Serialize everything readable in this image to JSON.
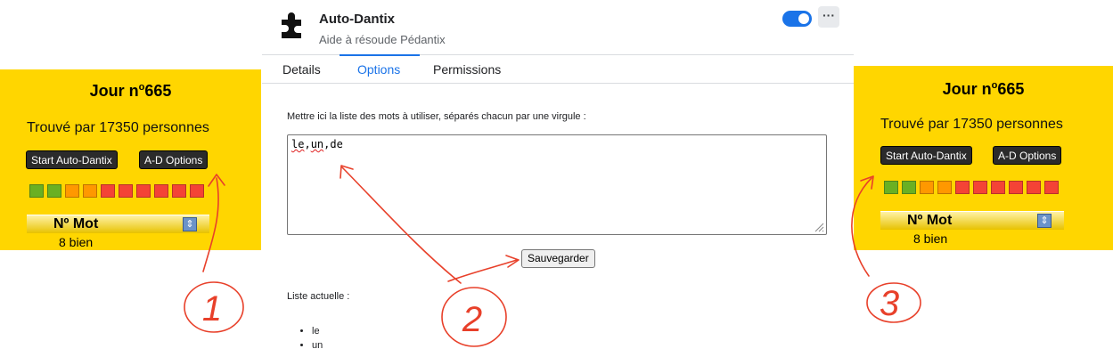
{
  "left_panel": {
    "jour_label": "Jour n",
    "jour_sup": "o",
    "jour_number": "665",
    "found_text": "Trouvé par 17350 personnes",
    "start_button": "Start Auto-Dantix",
    "options_button": "A-D Options",
    "squares": [
      "#6ab023",
      "#6ab023",
      "#ff9800",
      "#ff9800",
      "#f44336",
      "#f44336",
      "#f44336",
      "#f44336",
      "#f44336",
      "#f44336"
    ],
    "header_label": "Nº Mot",
    "sort_icon": "⇕",
    "row_text": "8 bien"
  },
  "right_panel": {
    "jour_label": "Jour n",
    "jour_sup": "o",
    "jour_number": "665",
    "found_text": "Trouvé par 17350 personnes",
    "start_button": "Start Auto-Dantix",
    "options_button": "A-D Options",
    "squares": [
      "#6ab023",
      "#6ab023",
      "#ff9800",
      "#ff9800",
      "#f44336",
      "#f44336",
      "#f44336",
      "#f44336",
      "#f44336",
      "#f44336"
    ],
    "header_label": "Nº Mot",
    "sort_icon": "⇕",
    "row_text": "8 bien"
  },
  "extension": {
    "title": "Auto-Dantix",
    "subtitle": "Aide à résoude Pédantix",
    "toggle_on": true,
    "more_icon": "···",
    "tabs": [
      {
        "label": "Details",
        "active": false
      },
      {
        "label": "Options",
        "active": true
      },
      {
        "label": "Permissions",
        "active": false
      }
    ],
    "instructions": "Mettre ici la liste des mots à utiliser, séparés chacun par une virgule :",
    "textarea_words": [
      "le",
      "un",
      "de"
    ],
    "textarea_sep": ",",
    "save_button": "Sauvegarder",
    "current_list_label": "Liste actuelle :",
    "current_list": [
      "le",
      "un"
    ]
  },
  "annotations": {
    "labels": [
      "1",
      "2",
      "3"
    ],
    "color": "#e8402a"
  }
}
